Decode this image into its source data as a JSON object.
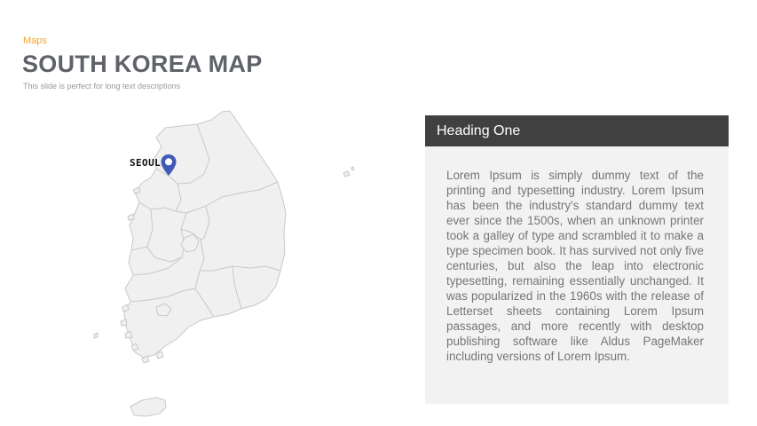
{
  "header": {
    "category": "Maps",
    "title": "SOUTH KOREA MAP",
    "subtitle": "This slide is perfect for long text descriptions"
  },
  "map": {
    "region": "South Korea",
    "fill_color": "#f0f0f0",
    "border_color": "#c8c8c8",
    "marker": {
      "label": "SEOUL",
      "icon": "map-pin-icon",
      "color": "#3f5bb5"
    }
  },
  "card": {
    "heading": "Heading One",
    "header_color": "#404040",
    "body_color": "#f2f2f2",
    "text": "Lorem Ipsum is simply dummy text of the printing and typesetting industry. Lorem Ipsum has been the industry's standard dummy text ever since the 1500s, when an unknown printer took a galley of type and scrambled it to make a type specimen book. It has survived not only five centuries, but also the leap into electronic typesetting, remaining essentially unchanged. It was popularized in the 1960s with the release of Letterset sheets containing Lorem Ipsum passages, and more recently with desktop publishing software like Aldus PageMaker including versions of Lorem Ipsum."
  }
}
